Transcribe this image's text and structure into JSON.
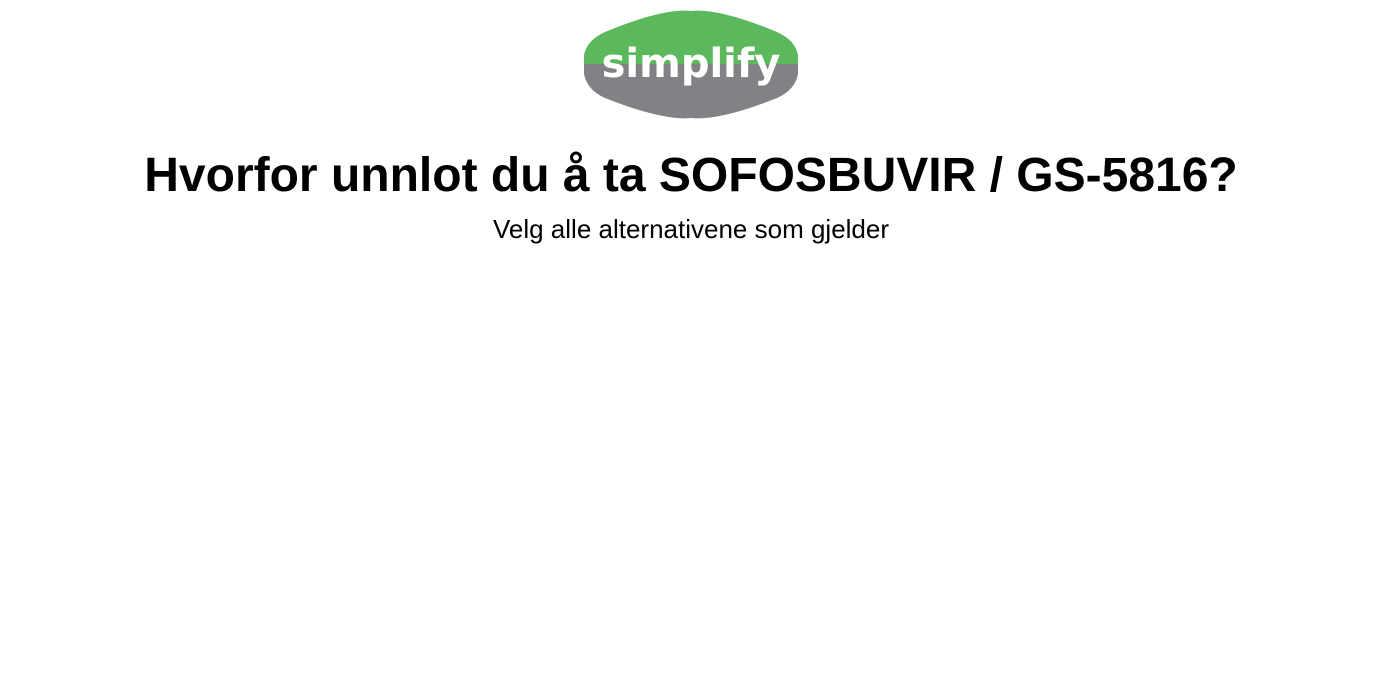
{
  "logo": {
    "text": "simplify",
    "colors": {
      "top": "#5cb85c",
      "bottom": "#808285",
      "text": "#ffffff"
    }
  },
  "question": {
    "title": "Hvorfor unnlot du å ta SOFOSBUVIR / GS-5816?",
    "subtitle": "Velg alle alternativene som gjelder"
  }
}
